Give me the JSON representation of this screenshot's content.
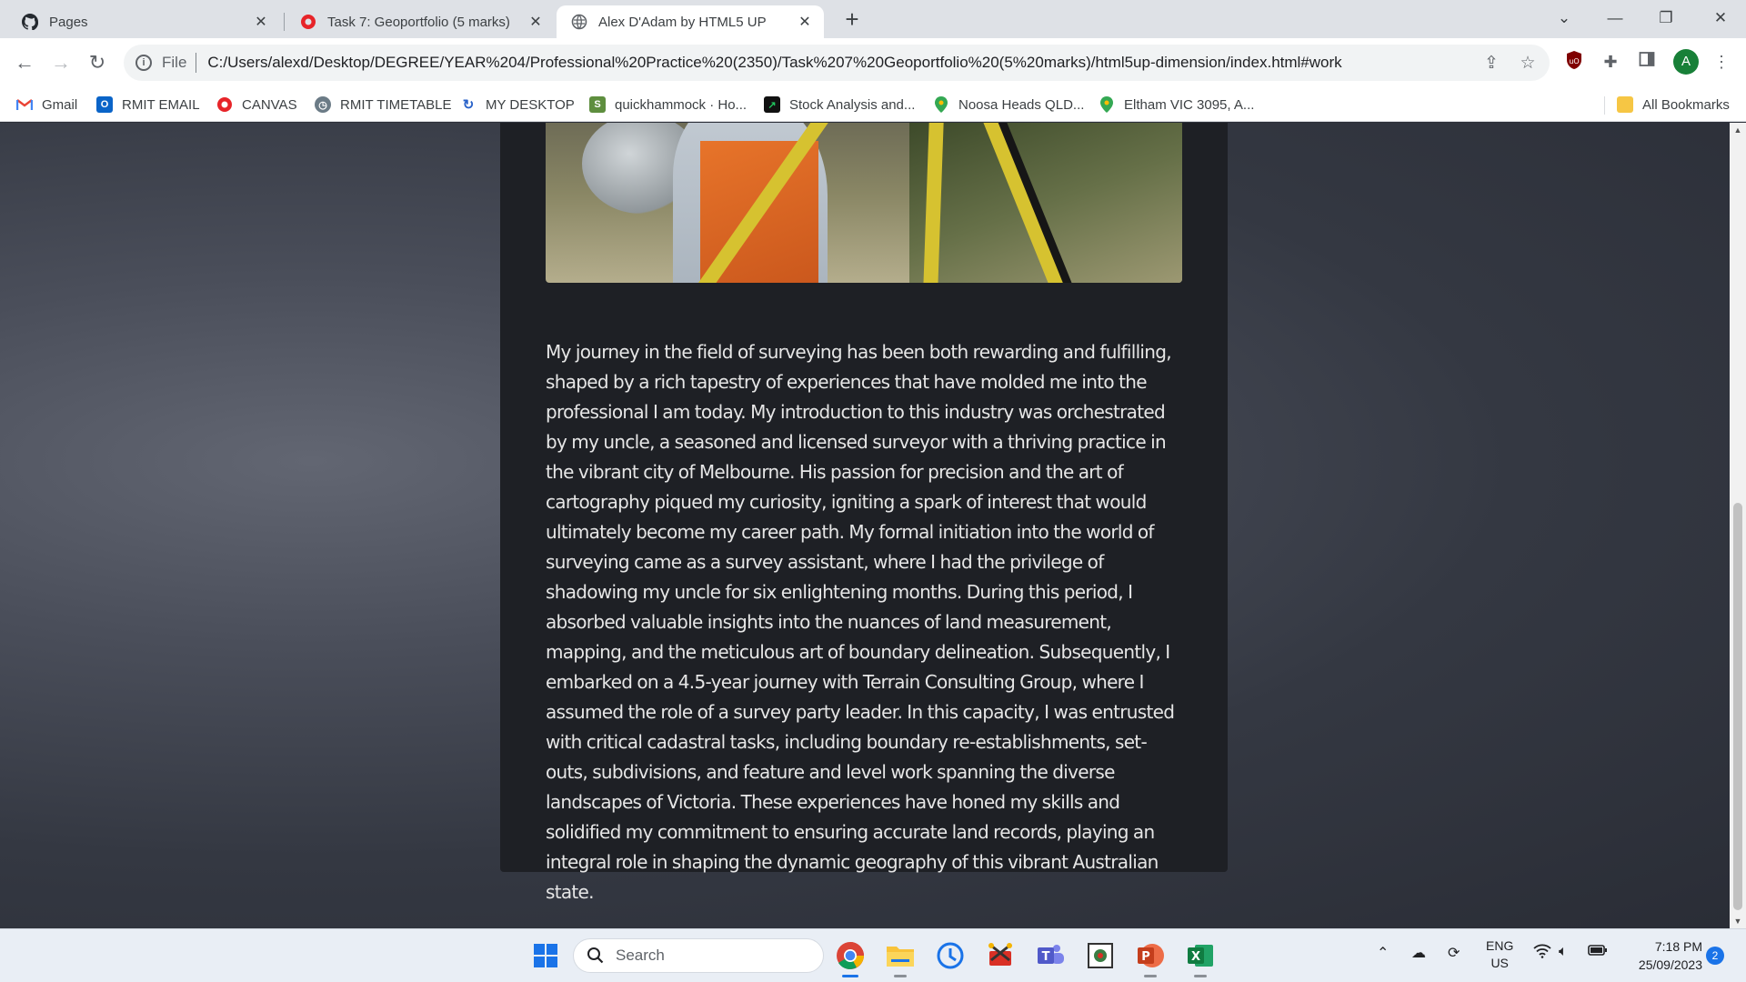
{
  "browser": {
    "tabs": [
      {
        "title": "Pages",
        "icon": "github-icon"
      },
      {
        "title": "Task 7: Geoportfolio (5 marks)",
        "icon": "canvas-icon"
      },
      {
        "title": "Alex D'Adam by HTML5 UP",
        "icon": "globe-icon",
        "active": true
      }
    ],
    "new_tab_label": "+",
    "omnibox": {
      "scheme_label": "File",
      "url": "C:/Users/alexd/Desktop/DEGREE/YEAR%204/Professional%20Practice%20(2350)/Task%207%20Geoportfolio%20(5%20marks)/html5up-dimension/index.html#work"
    },
    "profile_initial": "A",
    "bookmarks": [
      {
        "label": "Gmail",
        "icon": "gmail-icon"
      },
      {
        "label": "RMIT EMAIL",
        "icon": "outlook-icon"
      },
      {
        "label": "CANVAS",
        "icon": "canvas-icon"
      },
      {
        "label": "RMIT TIMETABLE",
        "icon": "timetable-icon"
      },
      {
        "label": "MY DESKTOP",
        "icon": "desktop-icon"
      },
      {
        "label": "quickhammock · Ho...",
        "icon": "shopify-icon"
      },
      {
        "label": "Stock Analysis and...",
        "icon": "stock-icon"
      },
      {
        "label": "Noosa Heads QLD...",
        "icon": "map-pin-icon"
      },
      {
        "label": "Eltham VIC 3095, A...",
        "icon": "map-pin-icon"
      }
    ],
    "all_bookmarks_label": "All Bookmarks"
  },
  "article": {
    "body": "My journey in the field of surveying has been both rewarding and fulfilling, shaped by a rich tapestry of experiences that have molded me into the professional I am today. My introduction to this industry was orchestrated by my uncle, a seasoned and licensed surveyor with a thriving practice in the vibrant city of Melbourne. His passion for precision and the art of cartography piqued my curiosity, igniting a spark of interest that would ultimately become my career path. My formal initiation into the world of surveying came as a survey assistant, where I had the privilege of shadowing my uncle for six enlightening months. During this period, I absorbed valuable insights into the nuances of land measurement, mapping, and the meticulous art of boundary delineation. Subsequently, I embarked on a 4.5-year journey with Terrain Consulting Group, where I assumed the role of a survey party leader. In this capacity, I was entrusted with critical cadastral tasks, including boundary re-establishments, set-outs, subdivisions, and feature and level work spanning the diverse landscapes of Victoria. These experiences have honed my skills and solidified my commitment to ensuring accurate land records, playing an integral role in shaping the dynamic geography of this vibrant Australian state."
  },
  "taskbar": {
    "search_label": "Search",
    "language_line1": "ENG",
    "language_line2": "US",
    "time": "7:18 PM",
    "date": "25/09/2023",
    "notification_count": "2"
  },
  "colors": {
    "panel": "#1e2025",
    "text": "#e6e6e6",
    "accent": "#1a73e8"
  }
}
